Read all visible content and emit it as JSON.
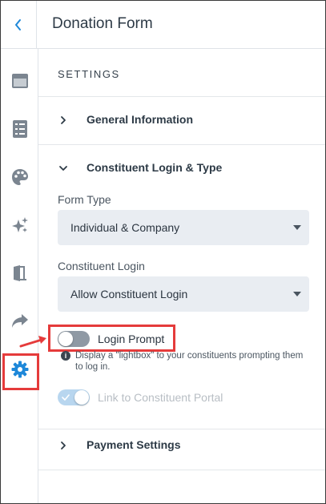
{
  "header": {
    "title": "Donation Form"
  },
  "sidebar": {
    "items": [
      {
        "name": "layout-icon"
      },
      {
        "name": "list-icon"
      },
      {
        "name": "palette-icon"
      },
      {
        "name": "sparkles-icon"
      },
      {
        "name": "exit-door-icon"
      },
      {
        "name": "share-arrow-icon"
      },
      {
        "name": "gear-icon",
        "active": true
      }
    ]
  },
  "settings": {
    "heading": "SETTINGS",
    "sections": {
      "general": "General Information",
      "constituent": "Constituent Login & Type",
      "payment": "Payment Settings"
    },
    "form_type": {
      "label": "Form Type",
      "value": "Individual & Company"
    },
    "constituent_login": {
      "label": "Constituent Login",
      "value": "Allow Constituent Login"
    },
    "login_prompt": {
      "label": "Login Prompt",
      "enabled": false,
      "help": "Display a \"lightbox\" to your constituents prompting them to log in."
    },
    "portal_link": {
      "label": "Link to Constituent Portal",
      "enabled": true,
      "disabled": true
    }
  },
  "colors": {
    "accent": "#1e88d9",
    "highlight": "#e53b3b",
    "select_bg": "#e9edf2"
  }
}
